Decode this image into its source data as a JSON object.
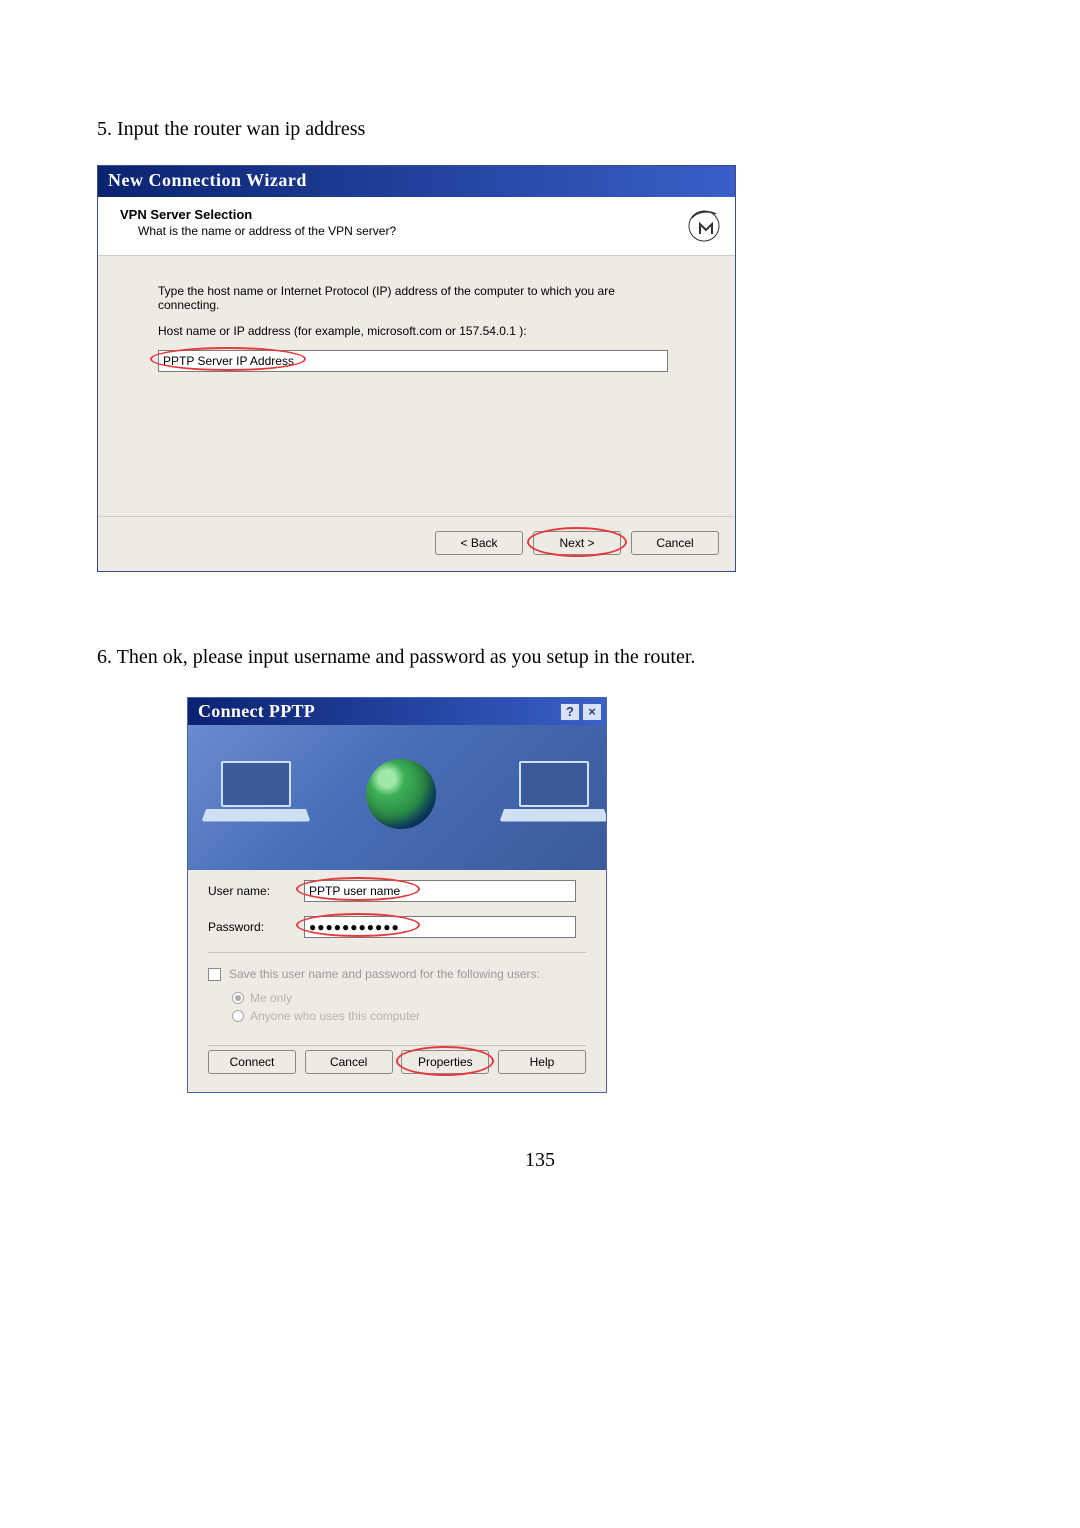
{
  "step5_text": "5. Input the router wan ip address",
  "step6_text": "6. Then ok, please input username and password as you setup in the router.",
  "page_number": "135",
  "wizard": {
    "titlebar": "New Connection Wizard",
    "header_title": "VPN Server Selection",
    "header_sub": "What is the name or address of the VPN server?",
    "body_line1": "Type the host name or Internet Protocol (IP) address of the computer to which you are connecting.",
    "body_label": "Host name or IP address (for example, microsoft.com or 157.54.0.1 ):",
    "input_value": "PPTP Server IP Address",
    "back_label": "< Back",
    "next_label": "Next >",
    "cancel_label": "Cancel"
  },
  "connect": {
    "titlebar": "Connect PPTP",
    "help_btn": "?",
    "close_btn": "×",
    "user_label": "User name:",
    "user_value": "PPTP user name",
    "pass_label": "Password:",
    "pass_value": "●●●●●●●●●●●",
    "save_label": "Save this user name and password for the following users:",
    "radio_me": "Me only",
    "radio_anyone": "Anyone who uses this computer",
    "connect_btn": "Connect",
    "cancel_btn": "Cancel",
    "props_btn": "Properties",
    "help_btn_lbl": "Help"
  }
}
